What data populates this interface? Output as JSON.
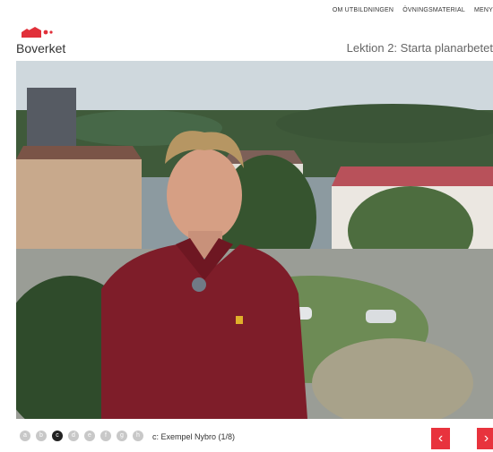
{
  "topnav": {
    "about": "OM UTBILDNINGEN",
    "exercises": "ÖVNINGSMATERIAL",
    "menu": "MENY"
  },
  "brand": {
    "name": "Boverket",
    "color": "#e1303a"
  },
  "lesson": {
    "title": "Lektion 2: Starta planarbetet"
  },
  "pager": {
    "dots": [
      "a",
      "b",
      "c",
      "d",
      "e",
      "f",
      "g",
      "h"
    ],
    "active_index": 2,
    "chapter_label": "c: Exempel Nybro (1/8)",
    "prev_icon": "chevron-left-icon",
    "next_icon": "chevron-right-icon",
    "prev_symbol": "‹",
    "next_symbol": "›",
    "accent": "#e8333d"
  }
}
